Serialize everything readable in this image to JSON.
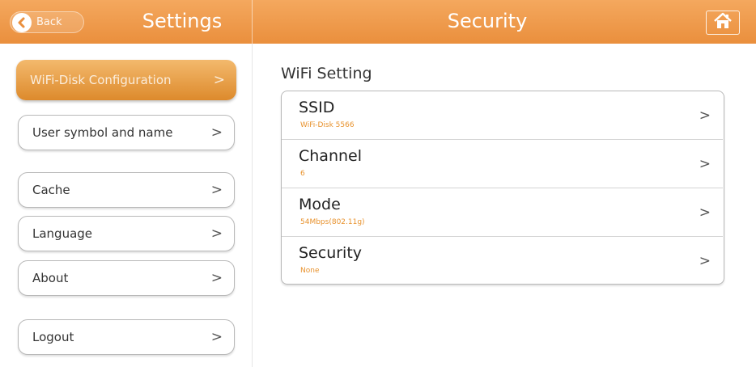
{
  "header": {
    "back_label": "Back",
    "settings_title": "Settings",
    "page_title": "Security",
    "icons": {
      "back": "back-arrow-icon",
      "home": "home-icon"
    },
    "accent_color": "#ea8f3d"
  },
  "sidebar": {
    "items": [
      {
        "label": "WiFi-Disk Configuration",
        "active": true
      },
      {
        "label": "User symbol and name"
      },
      {
        "label": "Cache"
      },
      {
        "label": "Language"
      },
      {
        "label": "About"
      },
      {
        "label": "Logout"
      }
    ],
    "chevron": ">"
  },
  "main": {
    "section_title": "WiFi Setting",
    "rows": [
      {
        "label": "SSID",
        "value": "WiFi-Disk 5566"
      },
      {
        "label": "Channel",
        "value": "6"
      },
      {
        "label": "Mode",
        "value": "54Mbps(802.11g)"
      },
      {
        "label": "Security",
        "value": "None"
      }
    ],
    "chevron": ">"
  }
}
